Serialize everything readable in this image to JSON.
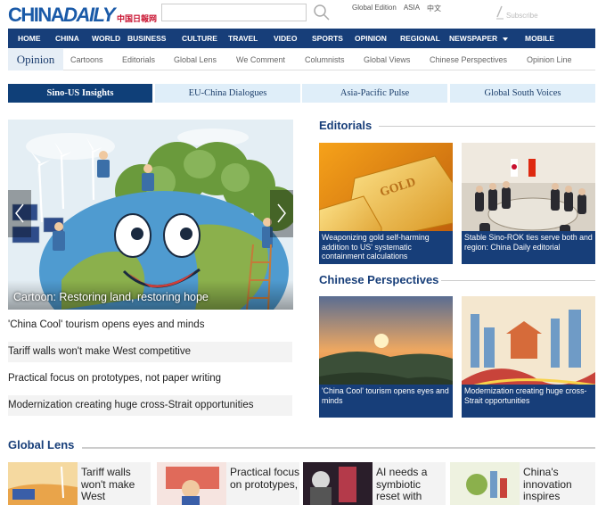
{
  "header": {
    "logo_main": "CHINA",
    "logo_daily": "DAILY",
    "logo_cn": "中国日報网",
    "search_placeholder": "",
    "top_links": [
      "Global Edition",
      "ASIA",
      "中文"
    ],
    "subscribe": "Subscribe"
  },
  "nav": {
    "items": [
      "HOME",
      "CHINA",
      "WORLD",
      "BUSINESS",
      "CULTURE",
      "TRAVEL",
      "VIDEO",
      "SPORTS",
      "OPINION",
      "REGIONAL",
      "NEWSPAPER",
      "MOBILE"
    ]
  },
  "subnav": {
    "title": "Opinion",
    "items": [
      "Cartoons",
      "Editorials",
      "Global Lens",
      "We Comment",
      "Columnists",
      "Global Views",
      "Chinese Perspectives",
      "Opinion Line"
    ]
  },
  "tabs": [
    {
      "label": "Sino-US Insights",
      "active": true
    },
    {
      "label": "EU-China Dialogues",
      "active": false
    },
    {
      "label": "Asia-Pacific Pulse",
      "active": false
    },
    {
      "label": "Global South Voices",
      "active": false
    }
  ],
  "hero": {
    "caption": "Cartoon: Restoring land, restoring hope"
  },
  "headlines": [
    "'China Cool' tourism opens eyes and minds",
    "Tariff walls won't make West competitive",
    "Practical focus on prototypes, not paper writing",
    "Modernization creating huge cross-Strait opportunities"
  ],
  "editorials": {
    "title": "Editorials",
    "cards": [
      {
        "caption": "Weaponizing gold self-harming addition to US' systematic containment calculations",
        "gold_text": "GOLD"
      },
      {
        "caption": "Stable Sino-ROK ties serve both and region: China Daily editorial"
      }
    ]
  },
  "perspectives": {
    "title": "Chinese Perspectives",
    "cards": [
      {
        "caption": "'China Cool' tourism opens eyes and minds"
      },
      {
        "caption": "Modernization creating huge cross-Strait opportunities"
      }
    ]
  },
  "global_lens": {
    "title": "Global Lens",
    "items": [
      {
        "text": "Tariff walls won't make West"
      },
      {
        "text": "Practical focus on prototypes,"
      },
      {
        "text": "AI needs a symbiotic reset with"
      },
      {
        "text": "China's innovation inspires"
      }
    ]
  },
  "colors": {
    "brand_blue": "#173e79",
    "tab_light": "#dfeef9",
    "logo_blue": "#1a5aa8"
  }
}
